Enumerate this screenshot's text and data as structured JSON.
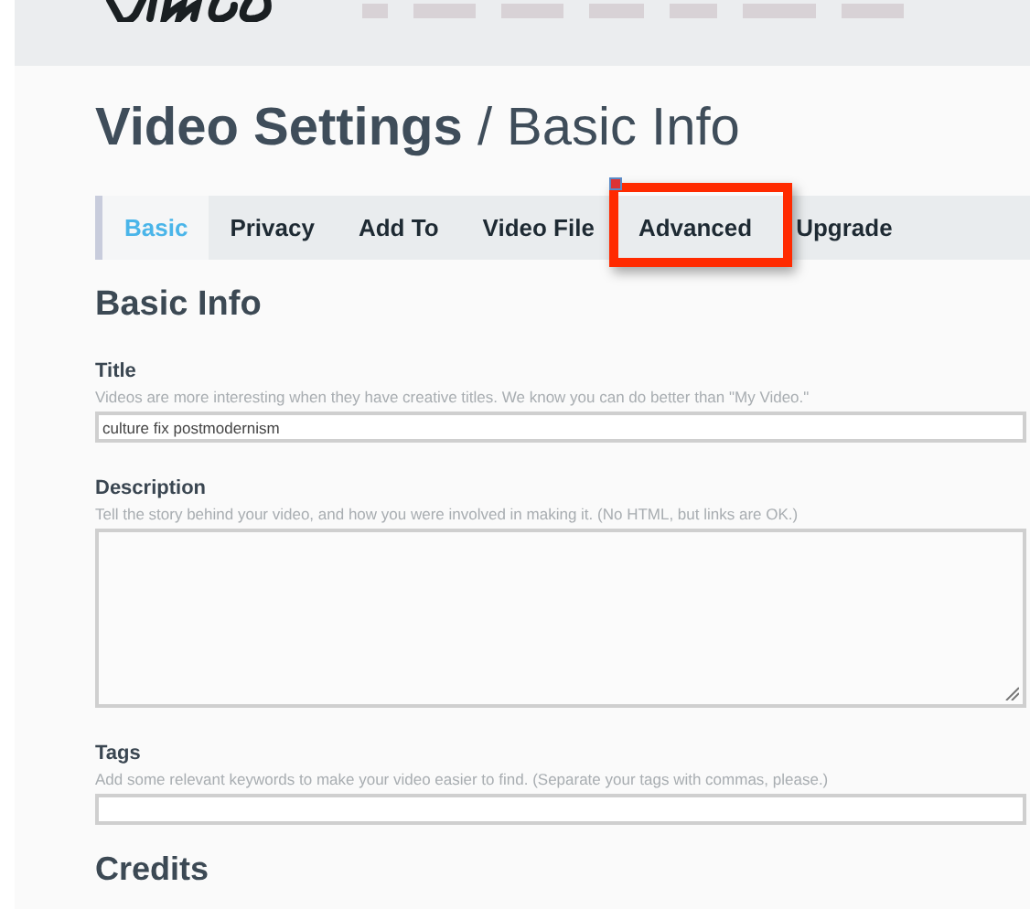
{
  "page_title": {
    "main": "Video Settings",
    "sub": "/ Basic Info"
  },
  "tabs": [
    {
      "label": "Basic",
      "selected": true,
      "highlighted": false
    },
    {
      "label": "Privacy",
      "selected": false,
      "highlighted": false
    },
    {
      "label": "Add To",
      "selected": false,
      "highlighted": false
    },
    {
      "label": "Video File",
      "selected": false,
      "highlighted": false
    },
    {
      "label": "Advanced",
      "selected": false,
      "highlighted": true
    },
    {
      "label": "Upgrade",
      "selected": false,
      "highlighted": false
    }
  ],
  "section_heading": "Basic Info",
  "fields": [
    {
      "kind": "input",
      "label": "Title",
      "hint": "Videos are more interesting when they have creative titles. We know you can do better than \"My Video.\"",
      "value": "culture fix postmodernism"
    },
    {
      "kind": "textarea",
      "label": "Description",
      "hint": "Tell the story behind your video, and how you were involved in making it. (No HTML, but links are OK.)"
    },
    {
      "kind": "input",
      "label": "Tags",
      "hint": "Add some relevant keywords to make your video easier to find. (Separate your tags with commas, please.)"
    }
  ],
  "next_heading": "Credits"
}
